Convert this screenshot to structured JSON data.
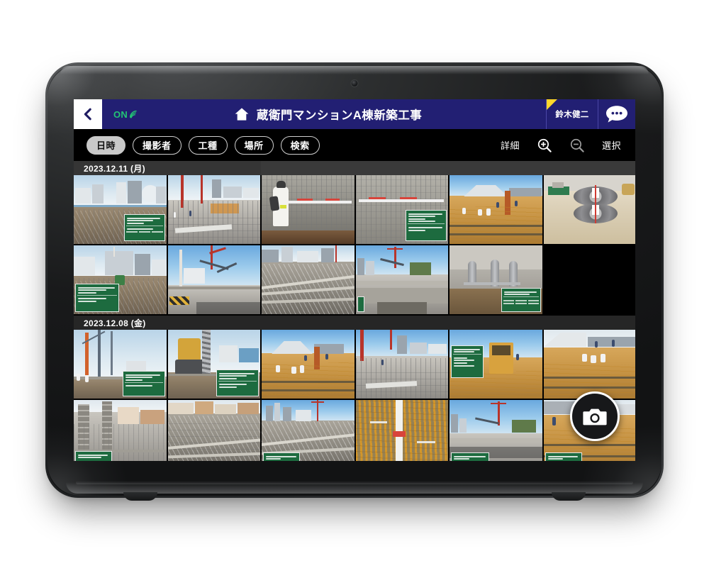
{
  "device": {
    "type": "rugged-tablet",
    "orientation": "landscape"
  },
  "appbar": {
    "back_icon": "chevron-left-icon",
    "connection_label": "ON",
    "connection_icon": "wifi-icon",
    "home_icon": "home-icon",
    "title": "蔵衛門マンションA棟新築工事",
    "user_name": "鈴木健二",
    "chat_icon": "speech-bubble-icon",
    "flag_color": "#ffd72b",
    "bar_color": "#221f73"
  },
  "toolbar": {
    "chips": [
      {
        "label": "日時",
        "active": true
      },
      {
        "label": "撮影者",
        "active": false
      },
      {
        "label": "工種",
        "active": false
      },
      {
        "label": "場所",
        "active": false
      },
      {
        "label": "検索",
        "active": false
      }
    ],
    "detail_label": "詳細",
    "zoom_in_icon": "zoom-in-icon",
    "zoom_out_icon": "zoom-out-icon",
    "select_label": "選択"
  },
  "gallery": {
    "columns": 6,
    "groups": [
      {
        "date": "2023.12.11 (月)",
        "photo_count": 11
      },
      {
        "date": "2023.12.08 (金)",
        "photo_count": 12
      }
    ]
  },
  "fab": {
    "icon": "camera-icon",
    "label": "撮影"
  }
}
